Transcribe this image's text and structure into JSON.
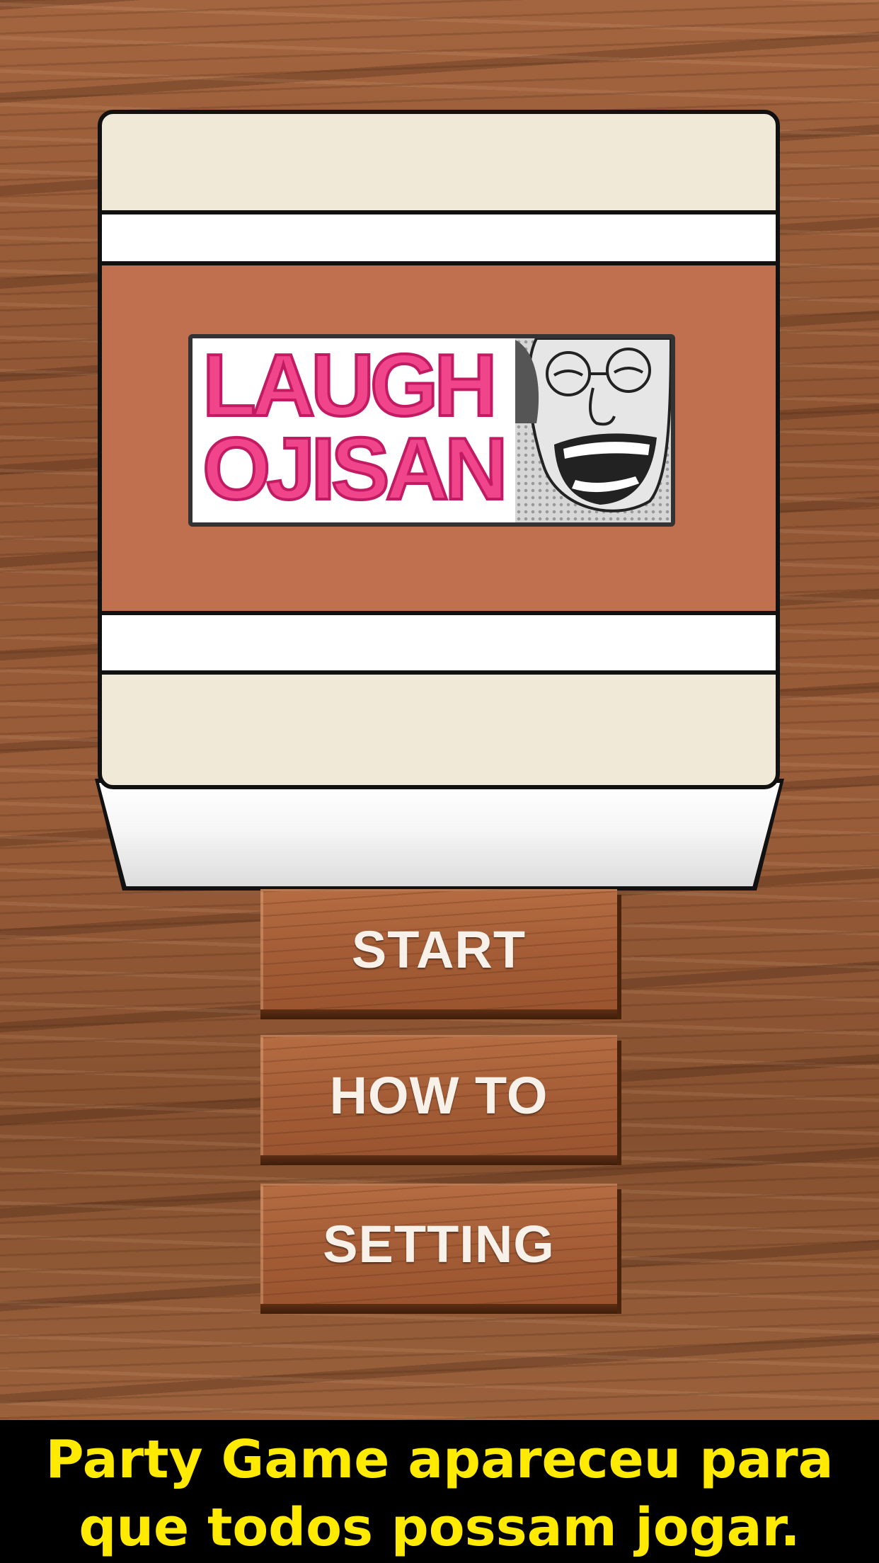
{
  "logo": {
    "line1": "LAUGH",
    "line2": "OJISAN",
    "face_icon": "laughing-man-face"
  },
  "menu": {
    "start_label": "START",
    "howto_label": "HOW TO",
    "setting_label": "SETTING"
  },
  "caption": {
    "line1": "Party Game apareceu para",
    "line2": "que todos possam jogar."
  },
  "colors": {
    "logo_pink": "#f0458a",
    "label_band": "#c0704f",
    "box_cream": "#f1e9d8",
    "caption_yellow": "#ffea00"
  }
}
